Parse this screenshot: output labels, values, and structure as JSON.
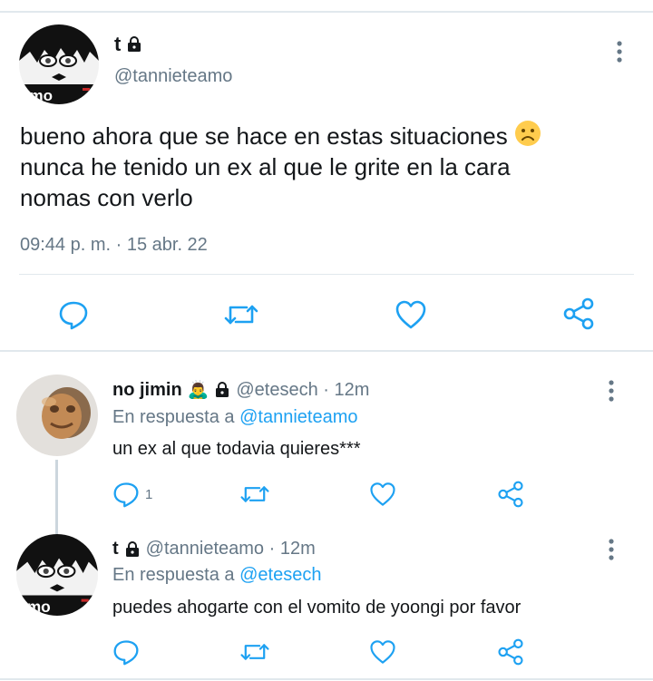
{
  "main_tweet": {
    "display_name": "t",
    "handle": "@tannieteamo",
    "avatar_text": "amo",
    "text_line1": "bueno ahora que se hace en estas situaciones",
    "text_line2": "nunca he tenido un ex al que le grite en la cara",
    "text_line3": "nomas con verlo",
    "timestamp": "09:44 p. m. · 15 abr. 22"
  },
  "replies": [
    {
      "display_name": "no jimin",
      "emoji": "🙇‍♂️",
      "meta": "@etesech · 12m",
      "reply_prefix": "En respuesta a",
      "reply_mention": "@tannieteamo",
      "text": "un ex al que todavia quieres***",
      "reply_count": "1"
    },
    {
      "display_name": "t",
      "meta": "@tannieteamo · 12m",
      "reply_prefix": "En respuesta a",
      "reply_mention": "@etesech",
      "text": "puedes ahogarte con el vomito de yoongi por favor",
      "avatar_text": "amo"
    }
  ],
  "icons": {
    "reply": "speech-bubble-icon",
    "retweet": "retweet-icon",
    "like": "heart-icon",
    "share": "share-icon",
    "more": "kebab-menu-icon",
    "lock": "lock-icon",
    "sad": "sad-face-emoji"
  },
  "colors": {
    "text": "#14171a",
    "secondary": "#657786",
    "accent": "#1da1f2",
    "divider": "#e1e8ed"
  }
}
